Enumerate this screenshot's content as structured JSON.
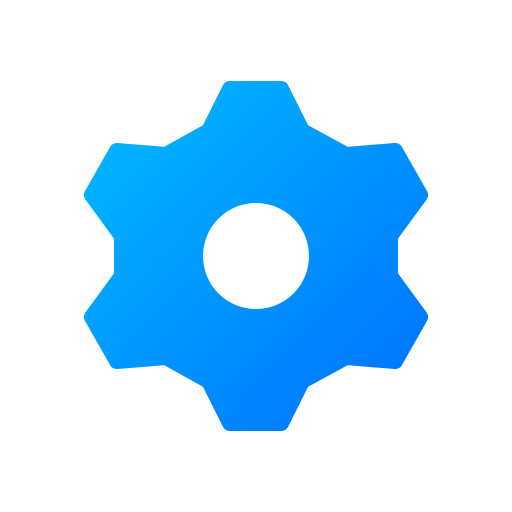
{
  "icon": {
    "name": "gear-icon",
    "colors": {
      "gradient_start": "#00BBFF",
      "gradient_end": "#0070FF",
      "hole": "#ffffff",
      "background": "#ffffff"
    }
  }
}
